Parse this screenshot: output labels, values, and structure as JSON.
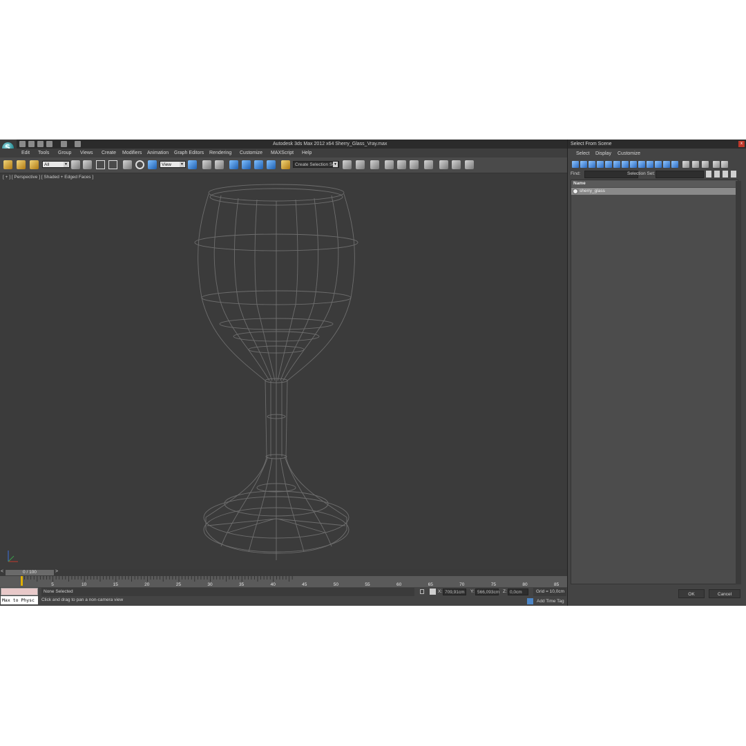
{
  "app": {
    "title": "Autodesk 3ds Max  2012 x64     Sherry_Glass_Vray.max",
    "logo_letter": "S",
    "menu": [
      "Edit",
      "Tools",
      "Group",
      "Views",
      "Create",
      "Modifiers",
      "Animation",
      "Graph Editors",
      "Rendering",
      "Customize",
      "MAXScript",
      "Help"
    ]
  },
  "toolbar": {
    "filter_value": "All",
    "coord_system": "View",
    "selection_set_placeholder": "Create Selection Se"
  },
  "viewport": {
    "label": "[ + ] [ Perspective ] [ Shaded + Edged Faces ]"
  },
  "timeline": {
    "frame_display": "0 / 100",
    "left_arrow": "<",
    "right_arrow": ">",
    "ticks": [
      "5",
      "10",
      "15",
      "20",
      "25",
      "30",
      "35",
      "40",
      "45",
      "50",
      "55",
      "60",
      "65",
      "70",
      "75",
      "80",
      "85"
    ]
  },
  "status": {
    "script_listener": "Max to Physc",
    "selection": "None Selected",
    "hint": "Click and drag to pan a non-camera view",
    "x_label": "X:",
    "x_value": "709,91cm",
    "y_label": "Y:",
    "y_value": "566,093cm",
    "z_label": "Z:",
    "z_value": "0,0cm",
    "grid": "Grid = 10,0cm",
    "add_time_tag": "Add Time Tag"
  },
  "dialog": {
    "title": "Select From Scene",
    "close": "x",
    "menu": [
      "Select",
      "Display",
      "Customize"
    ],
    "find_label": "Find:",
    "selection_set_label": "Selection Set:",
    "column_name": "Name",
    "items": [
      "sherry_glass"
    ],
    "ok": "OK",
    "cancel": "Cancel"
  }
}
